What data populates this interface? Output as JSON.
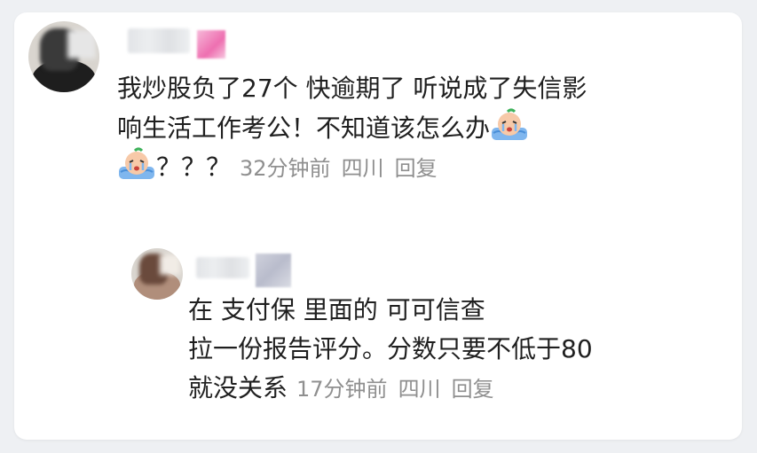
{
  "comment": {
    "line1": "我炒股负了27个 快逾期了  听说成了失信影",
    "line2": "响生活工作考公！不知道该怎么办",
    "line3_suffix": "？？？",
    "time": "32分钟前",
    "location": "四川",
    "reply_action": "回复",
    "emoji_icon": "crying-emoji-icon"
  },
  "reply": {
    "line1": "在 支付保  里面的  可可信查",
    "line2": "拉一份报告评分。分数只要不低于80",
    "line3": "就没关系",
    "time": "17分钟前",
    "location": "四川",
    "reply_action": "回复"
  },
  "colors": {
    "background": "#eef0f3",
    "card": "#ffffff",
    "text": "#1f1f1f",
    "meta": "#8f8f8f"
  }
}
